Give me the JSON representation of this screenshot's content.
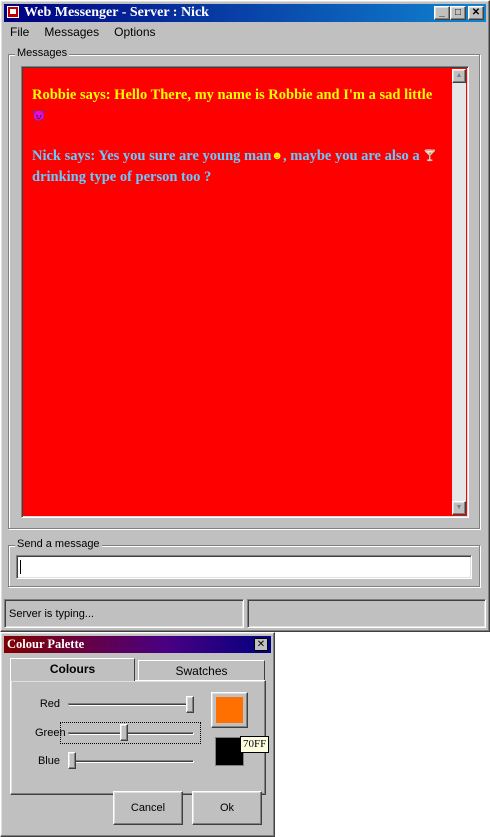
{
  "main_window": {
    "title": "Web Messenger - Server : Nick",
    "controls": {
      "minimize": "_",
      "maximize": "□",
      "close": "✕"
    },
    "menu": [
      "File",
      "Messages",
      "Options"
    ],
    "messages_label": "Messages",
    "messages_bg": "#ff0000",
    "messages": [
      {
        "speaker": "Robbie",
        "text_before": "Robbie says: Hello There, my name is Robbie and I'm a sad little",
        "icon": "devil-face-icon",
        "icon_glyph": "😈",
        "text_after": "",
        "color": "#ffff00"
      },
      {
        "speaker": "Nick",
        "text_before": "Nick says: Yes you sure are young man",
        "icon": "smiley-icon",
        "icon_glyph": "☻",
        "text_mid": ", maybe you are also a",
        "icon2": "cocktail-icon",
        "icon2_glyph": "🍸",
        "text_after": "drinking type of person too ?",
        "color": "#66ccff"
      }
    ],
    "send_label": "Send a message",
    "send_value": "",
    "status_text": "Server is typing...",
    "status_right": ""
  },
  "palette_window": {
    "title": "Colour Palette",
    "close": "✕",
    "tabs": [
      {
        "label": "Colours",
        "active": true
      },
      {
        "label": "Swatches",
        "active": false
      }
    ],
    "sliders": [
      {
        "label": "Red",
        "value": 255,
        "max": 255
      },
      {
        "label": "Green",
        "value": 112,
        "max": 255
      },
      {
        "label": "Blue",
        "value": 0,
        "max": 255
      }
    ],
    "swatch_primary": "#ff7000",
    "swatch_secondary": "#000000",
    "tooltip": "70FF",
    "cancel_label": "Cancel",
    "ok_label": "Ok"
  }
}
